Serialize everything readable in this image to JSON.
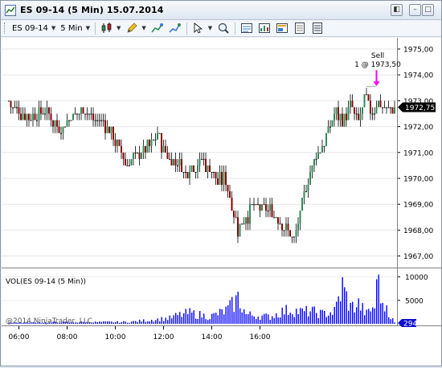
{
  "window": {
    "title": "ES 09-14 (5 Min)  15.07.2014",
    "controls": {
      "menu": "◧",
      "minimize": "–",
      "maximize": "□",
      "close": "×"
    }
  },
  "toolbar": {
    "instrument": "ES 09-14",
    "interval": "5 Min",
    "icons": [
      "candlestick-icon",
      "pencil-icon",
      "crosshair-add-icon",
      "lightning-icon",
      "cursor-icon",
      "zoom-icon",
      "data-box-icon",
      "chart-trader-icon",
      "properties-icon",
      "template-icon",
      "list-icon"
    ]
  },
  "price_panel": {
    "price_ticks": [
      "1975,00",
      "1974,00",
      "1973,00",
      "1972,00",
      "1971,00",
      "1970,00",
      "1969,00",
      "1968,00",
      "1967,00"
    ],
    "current_price": "1972,75",
    "trade_marker": {
      "label_line1": "Sell",
      "label_line2": "1 @ 1973,50",
      "arrow_color": "#ff00ff"
    }
  },
  "volume_panel": {
    "label": "VOL(ES 09-14 (5 Min))",
    "ticks": [
      "10000",
      "5000"
    ],
    "current_volume": "294",
    "copyright": "@2014 NinjaTrader, LLC"
  },
  "time_axis": {
    "labels": [
      "06:00",
      "08:00",
      "10:00",
      "12:00",
      "14:00",
      "16:00"
    ]
  },
  "colors": {
    "up": "#2e8b57",
    "down": "#8b0000",
    "neutral": "#000000",
    "volume": "#0000ff",
    "price_box": "#000000"
  },
  "chart_data": {
    "type": "candlestick",
    "interval_minutes": 5,
    "start_time": "05:35",
    "ylim": [
      1966.75,
      1975.5
    ],
    "volume_ylim": [
      0,
      12000
    ],
    "close_anchors": [
      [
        0,
        1972.9
      ],
      [
        6,
        1972.5
      ],
      [
        12,
        1972.4
      ],
      [
        18,
        1972.6
      ],
      [
        22,
        1972.2
      ],
      [
        26,
        1971.9
      ],
      [
        30,
        1972.3
      ],
      [
        34,
        1972.6
      ],
      [
        38,
        1972.7
      ],
      [
        42,
        1972.3
      ],
      [
        46,
        1972.2
      ],
      [
        50,
        1971.9
      ],
      [
        54,
        1971.3
      ],
      [
        58,
        1970.6
      ],
      [
        62,
        1970.8
      ],
      [
        66,
        1971.0
      ],
      [
        70,
        1971.3
      ],
      [
        74,
        1971.8
      ],
      [
        76,
        1971.2
      ],
      [
        80,
        1970.7
      ],
      [
        84,
        1970.6
      ],
      [
        88,
        1970.2
      ],
      [
        92,
        1970.5
      ],
      [
        96,
        1970.7
      ],
      [
        100,
        1970.4
      ],
      [
        104,
        1969.9
      ],
      [
        108,
        1970.0
      ],
      [
        112,
        1968.7
      ],
      [
        114,
        1968.0
      ],
      [
        118,
        1968.5
      ],
      [
        122,
        1968.9
      ],
      [
        126,
        1968.8
      ],
      [
        130,
        1968.8
      ],
      [
        134,
        1968.4
      ],
      [
        138,
        1968.0
      ],
      [
        140,
        1967.8
      ],
      [
        142,
        1967.6
      ],
      [
        144,
        1968.2
      ],
      [
        148,
        1969.6
      ],
      [
        150,
        1970.3
      ],
      [
        154,
        1971.0
      ],
      [
        158,
        1971.6
      ],
      [
        162,
        1972.6
      ],
      [
        166,
        1972.2
      ],
      [
        170,
        1972.7
      ],
      [
        174,
        1972.3
      ],
      [
        178,
        1973.2
      ],
      [
        180,
        1972.5
      ],
      [
        184,
        1973.0
      ],
      [
        188,
        1972.6
      ],
      [
        192,
        1972.75
      ]
    ],
    "volume_anchors": [
      [
        0,
        250
      ],
      [
        60,
        400
      ],
      [
        80,
        1200
      ],
      [
        84,
        1800
      ],
      [
        90,
        2300
      ],
      [
        100,
        1500
      ],
      [
        108,
        2800
      ],
      [
        112,
        4300
      ],
      [
        114,
        5500
      ],
      [
        118,
        2000
      ],
      [
        124,
        1700
      ],
      [
        130,
        1500
      ],
      [
        136,
        2600
      ],
      [
        140,
        3000
      ],
      [
        146,
        2500
      ],
      [
        150,
        2700
      ],
      [
        156,
        2100
      ],
      [
        162,
        2600
      ],
      [
        166,
        7800
      ],
      [
        170,
        3500
      ],
      [
        174,
        4200
      ],
      [
        178,
        2100
      ],
      [
        182,
        3800
      ],
      [
        184,
        10500
      ],
      [
        186,
        3200
      ],
      [
        188,
        4000
      ],
      [
        190,
        1500
      ],
      [
        192,
        294
      ]
    ],
    "sell_marker": {
      "bar": 183,
      "price": 1973.5,
      "quantity": 1
    }
  }
}
